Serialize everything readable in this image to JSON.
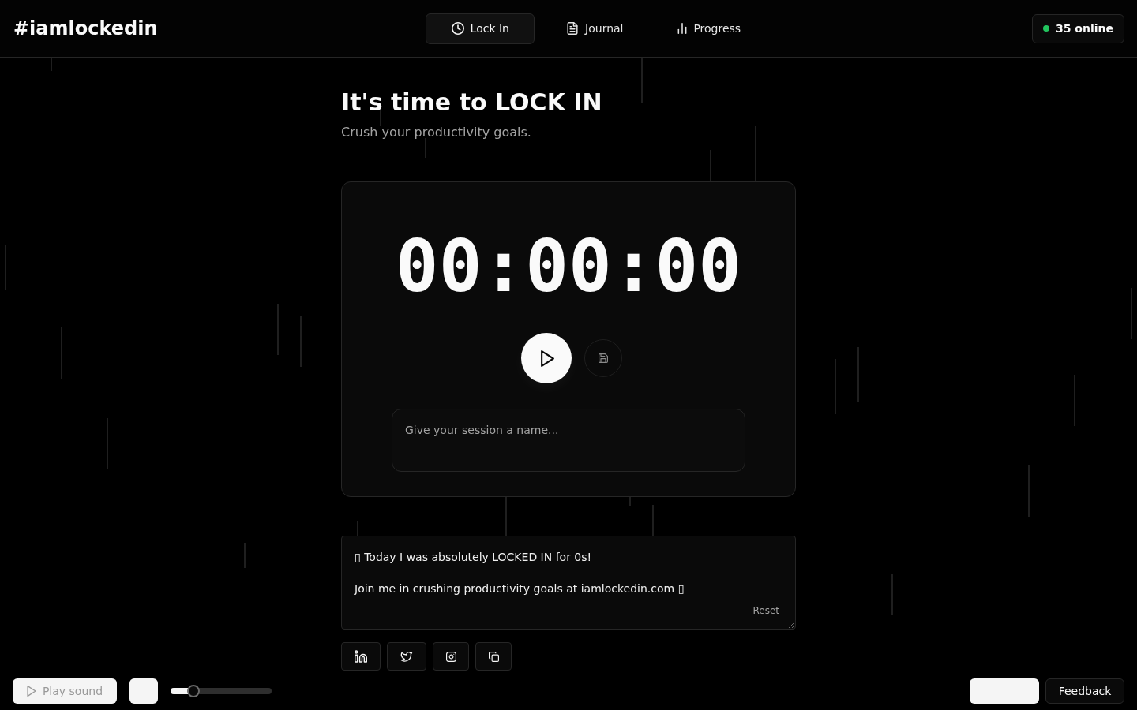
{
  "header": {
    "logo": "#iamlockedin",
    "tabs": [
      {
        "kind": "timer",
        "label": "Lock In",
        "selected": true
      },
      {
        "kind": "journal",
        "label": "Journal",
        "selected": false
      },
      {
        "kind": "progress",
        "label": "Progress",
        "selected": false
      }
    ],
    "online_badge": "35 online"
  },
  "hero": {
    "title": "It's time to LOCK IN",
    "subtitle": "Crush your productivity goals."
  },
  "timer_card": {
    "time": "00:00:00",
    "session_name": {
      "placeholder": "Give your session a name..."
    }
  },
  "share": {
    "message": "▯ Today I was absolutely LOCKED IN for 0s!\n\nJoin me in crushing productivity goals at iamlockedin.com ▯",
    "reset_label": "Reset",
    "buttons": [
      {
        "kind": "linkedin"
      },
      {
        "kind": "twitter"
      },
      {
        "kind": "instagram"
      },
      {
        "kind": "copy"
      }
    ]
  },
  "sound": {
    "play_button": {
      "label": "Play sound",
      "disabled": true
    },
    "volume": {
      "level": 0.23
    }
  },
  "feedback_button": "Feedback"
}
